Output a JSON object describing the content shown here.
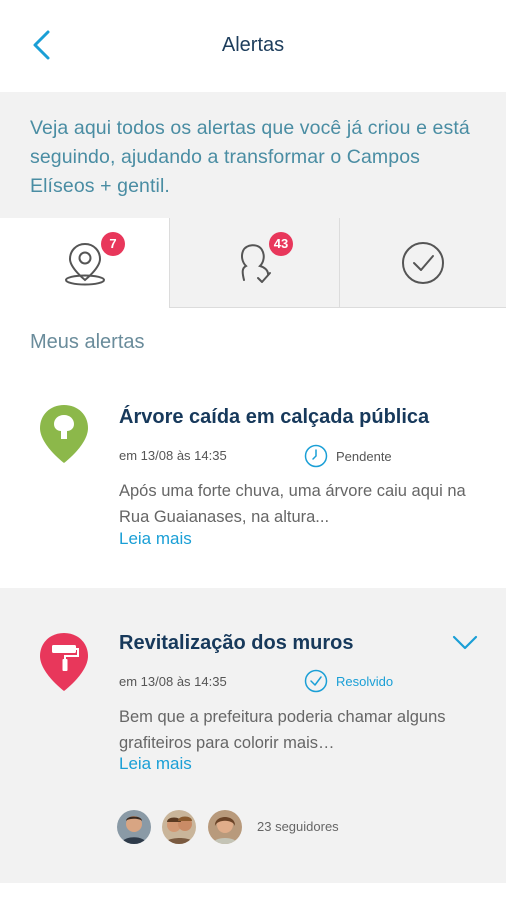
{
  "header": {
    "title": "Alertas"
  },
  "intro": {
    "text": "Veja aqui todos os alertas que você já criou e está seguindo, ajudando a transformar o Campos Elíseos + gentil."
  },
  "tabs": [
    {
      "icon": "location-pin-icon",
      "badge": "7",
      "active": true
    },
    {
      "icon": "person-check-icon",
      "badge": "43",
      "active": false
    },
    {
      "icon": "check-circle-icon",
      "badge": "",
      "active": false
    }
  ],
  "section": {
    "title": "Meus alertas"
  },
  "alerts": [
    {
      "icon": "tree-pin-icon",
      "color": "#8cb84a",
      "title": "Árvore caída em calçada pública",
      "date": "em 13/08 às 14:35",
      "status_icon": "clock-icon",
      "status": "Pendente",
      "status_color": "#555555",
      "description": "Após uma forte chuva, uma árvore caiu aqui na Rua Guaianases, na altura...",
      "read_more": "Leia mais"
    },
    {
      "icon": "paint-roller-pin-icon",
      "color": "#e8375b",
      "title": "Revitalização dos muros",
      "date": "em 13/08 às 14:35",
      "status_icon": "check-circle-icon",
      "status": "Resolvido",
      "status_color": "#1a9fd6",
      "description": "Bem que a prefeitura poderia chamar alguns grafiteiros para colorir mais…",
      "read_more": "Leia mais",
      "followers": "23 seguidores"
    }
  ],
  "colors": {
    "accent": "#1a9fd6",
    "badge": "#e8375b",
    "title": "#17395b"
  }
}
